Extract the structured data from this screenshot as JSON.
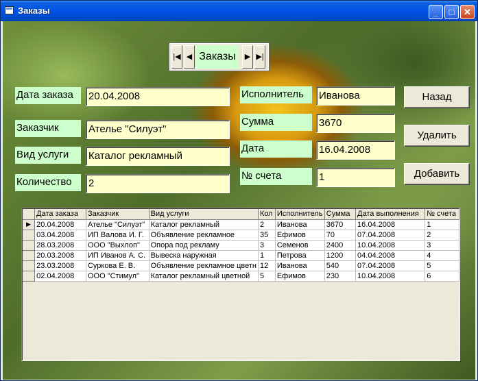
{
  "window": {
    "title": "Заказы",
    "controls": {
      "minimize": "_",
      "maximize": "□",
      "close": "✕"
    }
  },
  "navigator": {
    "caption": "Заказы",
    "first": "|◀",
    "prev": "◀",
    "next": "▶",
    "last": "▶|"
  },
  "form": {
    "order_date": {
      "label": "Дата заказа",
      "value": "20.04.2008"
    },
    "customer": {
      "label": "Заказчик",
      "value": "Ателье \"Силуэт\""
    },
    "service": {
      "label": "Вид услуги",
      "value": "Каталог рекламный"
    },
    "quantity": {
      "label": "Количество",
      "value": "2"
    },
    "executor": {
      "label": "Исполнитель",
      "value": "Иванова"
    },
    "sum": {
      "label": "Сумма",
      "value": "3670"
    },
    "date": {
      "label": "Дата",
      "value": "16.04.2008"
    },
    "invoice": {
      "label": "№ счета",
      "value": "1"
    }
  },
  "buttons": {
    "back": "Назад",
    "delete": "Удалить",
    "add": "Добавить"
  },
  "grid": {
    "columns": [
      "Дата заказа",
      "Заказчик",
      "Вид услуги",
      "Кол",
      "Исполнитель",
      "Сумма",
      "Дата выполнения",
      "№ счета"
    ],
    "current_row_marker": "▶",
    "rows": [
      [
        "20.04.2008",
        "Ателье \"Силуэт\"",
        "Каталог рекламный",
        "2",
        "Иванова",
        "3670",
        "16.04.2008",
        "1"
      ],
      [
        "03.04.2008",
        "ИП Валова И. Г.",
        "Объявление рекламное",
        "35",
        "Ефимов",
        "70",
        "07.04.2008",
        "2"
      ],
      [
        "28.03.2008",
        "ООО \"Выхлоп\"",
        "Опора под рекламу",
        "3",
        "Семенов",
        "2400",
        "10.04.2008",
        "3"
      ],
      [
        "20.03.2008",
        "ИП Иванов А. С.",
        "Вывеска наружная",
        "1",
        "Петрова",
        "1200",
        "04.04.2008",
        "4"
      ],
      [
        "23.03.2008",
        "Суркова Е. В.",
        "Объявление рекламное цветн",
        "12",
        "Иванова",
        "540",
        "07.04.2008",
        "5"
      ],
      [
        "02.04.2008",
        "ООО \"Стимул\"",
        "Каталог рекламный цветной",
        "5",
        "Ефимов",
        "230",
        "10.04.2008",
        "6"
      ]
    ]
  },
  "colors": {
    "label_bg": "#ccffcc",
    "field_bg": "#ffffcc",
    "title_bar": "#0054e3"
  }
}
